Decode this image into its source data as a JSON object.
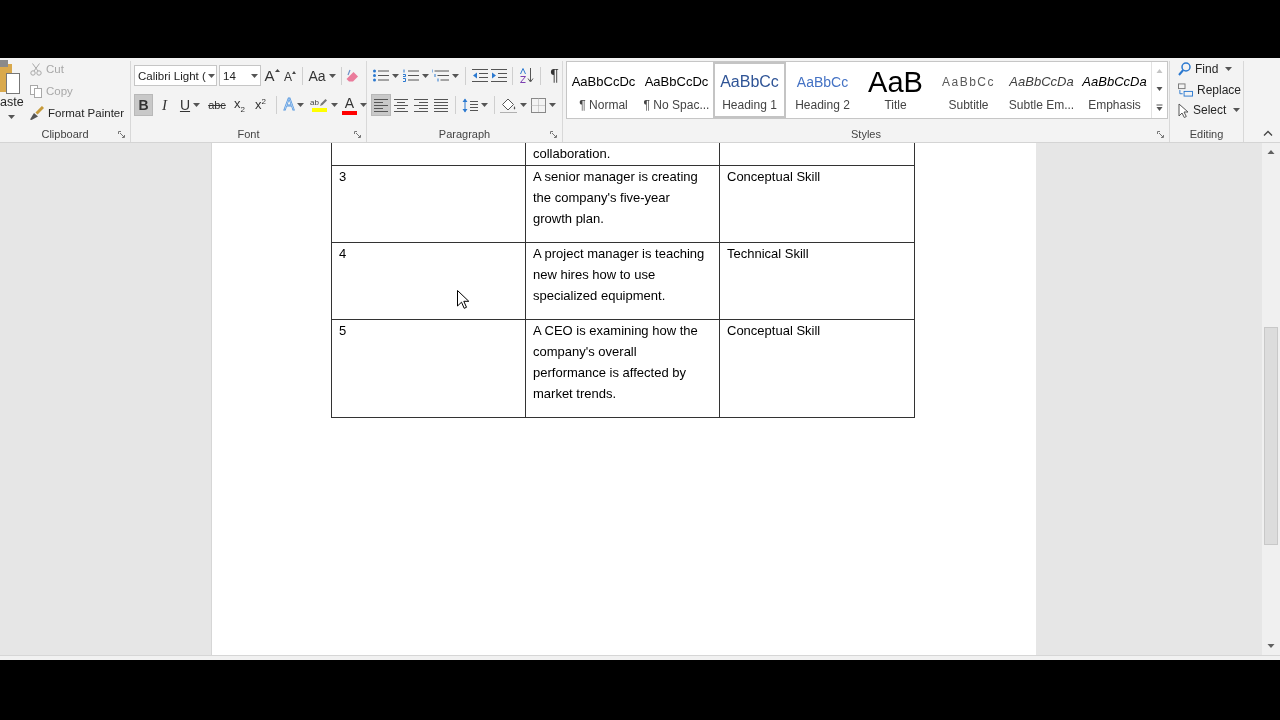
{
  "ribbon": {
    "clipboard": {
      "paste": "aste",
      "items": [
        {
          "kind": "cut",
          "label": "Cut",
          "disabled": true
        },
        {
          "kind": "copy",
          "label": "Copy",
          "disabled": true
        },
        {
          "kind": "format-painter",
          "label": "Format Painter",
          "disabled": false
        }
      ],
      "label": "Clipboard"
    },
    "font": {
      "font_name": "Calibri Light (",
      "font_size": "14",
      "grow_font": "A",
      "shrink_font": "A",
      "change_case": "Aa",
      "toggles": [
        {
          "kind": "bold",
          "label": "B",
          "on": true
        },
        {
          "kind": "italic",
          "label": "I",
          "on": false
        },
        {
          "kind": "underline",
          "label": "U",
          "on": false
        },
        {
          "kind": "strikethrough",
          "label": "abc",
          "on": false
        },
        {
          "kind": "subscript",
          "label": "x$_{2}$",
          "on": false
        },
        {
          "kind": "superscript",
          "label": "x$^{2}$",
          "on": false
        }
      ],
      "text_effects": "A",
      "highlight": {
        "label": "ab",
        "color": "#ffff00"
      },
      "font_color": {
        "label": "A",
        "color": "#ff0000"
      },
      "label": "Font"
    },
    "paragraph": {
      "show_marks": "¶",
      "alignment": [
        {
          "kind": "left",
          "selected": true
        },
        {
          "kind": "center",
          "selected": false
        },
        {
          "kind": "right",
          "selected": false
        },
        {
          "kind": "justify",
          "selected": false
        }
      ],
      "label": "Paragraph"
    },
    "styles": {
      "items": [
        {
          "kind": "normal",
          "preview": "AaBbCcDc",
          "name": "¶ Normal",
          "selected": false
        },
        {
          "kind": "no-spacing",
          "preview": "AaBbCcDc",
          "name": "¶ No Spac...",
          "selected": false
        },
        {
          "kind": "heading1",
          "preview": "AaBbCc",
          "name": "Heading 1",
          "selected": true
        },
        {
          "kind": "heading2",
          "preview": "AaBbCc",
          "name": "Heading 2",
          "selected": false
        },
        {
          "kind": "title",
          "preview": "AaB",
          "name": "Title",
          "selected": false
        },
        {
          "kind": "subtitle",
          "preview": "AaBbCc",
          "name": "Subtitle",
          "selected": false
        },
        {
          "kind": "subtle-emphasis",
          "preview": "AaBbCcDa",
          "name": "Subtle Em...",
          "selected": false
        },
        {
          "kind": "emphasis",
          "preview": "AaBbCcDa",
          "name": "Emphasis",
          "selected": false
        }
      ],
      "label": "Styles"
    },
    "editing": {
      "items": [
        {
          "kind": "find",
          "label": "Find"
        },
        {
          "kind": "replace",
          "label": "Replace"
        },
        {
          "kind": "select",
          "label": "Select"
        }
      ],
      "label": "Editing"
    }
  },
  "document": {
    "table": {
      "rows": [
        {
          "column_2": "collaboration."
        },
        {
          "column_1": "3",
          "column_2": "A senior manager is creating the company's five-year growth plan.",
          "column_3": "Conceptual Skill"
        },
        {
          "column_1": "4",
          "column_2": "A project manager is teaching new hires how to use specialized equipment.",
          "column_3": "Technical Skill"
        },
        {
          "column_1": "5",
          "column_2": "A CEO is examining how the company's overall performance is affected by market trends.",
          "column_3": "Conceptual Skill"
        }
      ]
    }
  }
}
